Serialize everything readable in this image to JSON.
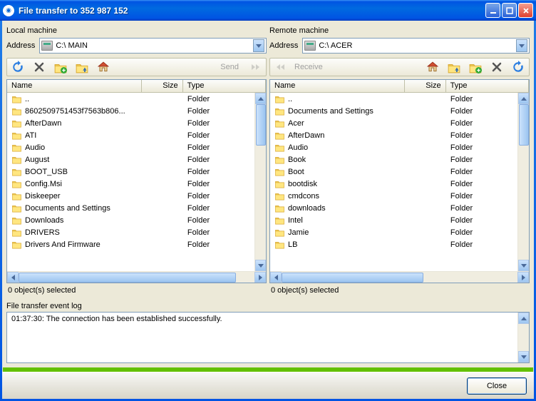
{
  "title": "File transfer to 352 987 152",
  "local": {
    "title": "Local machine",
    "address_label": "Address",
    "address_value": "C:\\  MAIN",
    "send_label": "Send",
    "columns": {
      "name": "Name",
      "size": "Size",
      "type": "Type"
    },
    "items": [
      {
        "name": "..",
        "type": "Folder"
      },
      {
        "name": "8602509751453f7563b806...",
        "type": "Folder"
      },
      {
        "name": "AfterDawn",
        "type": "Folder"
      },
      {
        "name": "ATI",
        "type": "Folder"
      },
      {
        "name": "Audio",
        "type": "Folder"
      },
      {
        "name": "August",
        "type": "Folder"
      },
      {
        "name": "BOOT_USB",
        "type": "Folder"
      },
      {
        "name": "Config.Msi",
        "type": "Folder"
      },
      {
        "name": "Diskeeper",
        "type": "Folder"
      },
      {
        "name": "Documents and Settings",
        "type": "Folder"
      },
      {
        "name": "Downloads",
        "type": "Folder"
      },
      {
        "name": "DRIVERS",
        "type": "Folder"
      },
      {
        "name": "Drivers And Firmware",
        "type": "Folder"
      }
    ],
    "status": "0 object(s) selected"
  },
  "remote": {
    "title": "Remote machine",
    "address_label": "Address",
    "address_value": "C:\\  ACER",
    "receive_label": "Receive",
    "columns": {
      "name": "Name",
      "size": "Size",
      "type": "Type"
    },
    "items": [
      {
        "name": "..",
        "type": "Folder"
      },
      {
        "name": "Documents and Settings",
        "type": "Folder"
      },
      {
        "name": "Acer",
        "type": "Folder"
      },
      {
        "name": "AfterDawn",
        "type": "Folder"
      },
      {
        "name": "Audio",
        "type": "Folder"
      },
      {
        "name": "Book",
        "type": "Folder"
      },
      {
        "name": "Boot",
        "type": "Folder"
      },
      {
        "name": "bootdisk",
        "type": "Folder"
      },
      {
        "name": "cmdcons",
        "type": "Folder"
      },
      {
        "name": "downloads",
        "type": "Folder"
      },
      {
        "name": "Intel",
        "type": "Folder"
      },
      {
        "name": "Jamie",
        "type": "Folder"
      },
      {
        "name": "LB",
        "type": "Folder"
      }
    ],
    "status": "0 object(s) selected"
  },
  "log": {
    "label": "File transfer event log",
    "entries": [
      "01:37:30: The connection has been established successfully."
    ]
  },
  "close_label": "Close"
}
